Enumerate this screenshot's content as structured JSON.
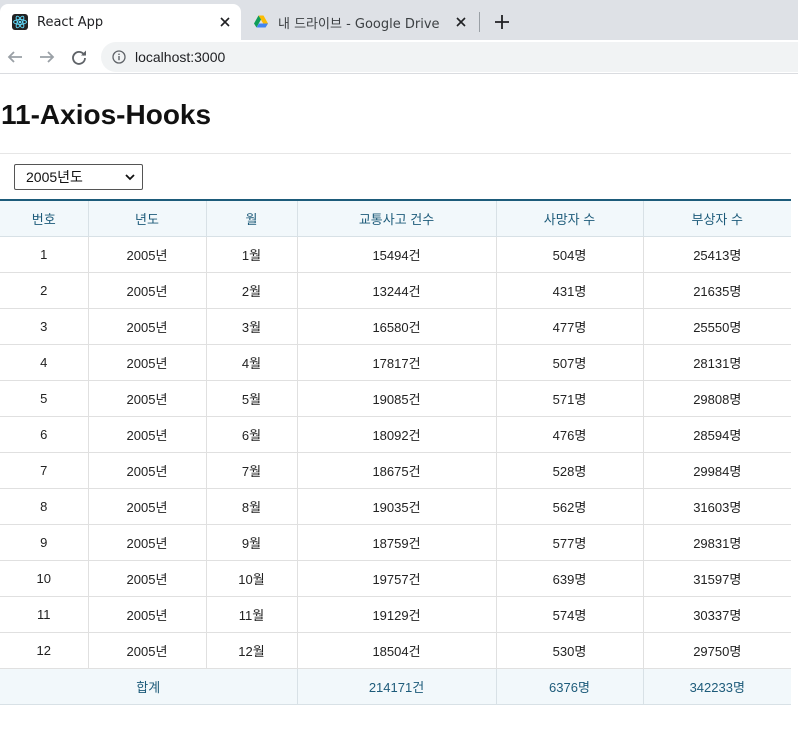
{
  "browser": {
    "active_tab_title": "React App",
    "inactive_tab_title": "내 드라이브 - Google Drive",
    "url": "localhost:3000"
  },
  "page": {
    "title": "11-Axios-Hooks",
    "year_select": {
      "selected": "2005년도"
    }
  },
  "table": {
    "headers": [
      "번호",
      "년도",
      "월",
      "교통사고 건수",
      "사망자 수",
      "부상자 수"
    ],
    "rows": [
      [
        "1",
        "2005년",
        "1월",
        "15494건",
        "504명",
        "25413명"
      ],
      [
        "2",
        "2005년",
        "2월",
        "13244건",
        "431명",
        "21635명"
      ],
      [
        "3",
        "2005년",
        "3월",
        "16580건",
        "477명",
        "25550명"
      ],
      [
        "4",
        "2005년",
        "4월",
        "17817건",
        "507명",
        "28131명"
      ],
      [
        "5",
        "2005년",
        "5월",
        "19085건",
        "571명",
        "29808명"
      ],
      [
        "6",
        "2005년",
        "6월",
        "18092건",
        "476명",
        "28594명"
      ],
      [
        "7",
        "2005년",
        "7월",
        "18675건",
        "528명",
        "29984명"
      ],
      [
        "8",
        "2005년",
        "8월",
        "19035건",
        "562명",
        "31603명"
      ],
      [
        "9",
        "2005년",
        "9월",
        "18759건",
        "577명",
        "29831명"
      ],
      [
        "10",
        "2005년",
        "10월",
        "19757건",
        "639명",
        "31597명"
      ],
      [
        "11",
        "2005년",
        "11월",
        "19129건",
        "574명",
        "30337명"
      ],
      [
        "12",
        "2005년",
        "12월",
        "18504건",
        "530명",
        "29750명"
      ]
    ],
    "footer": {
      "label": "합계",
      "accidents": "214171건",
      "deaths": "6376명",
      "injuries": "342233명"
    }
  },
  "colors": {
    "accent": "#1d5b7a",
    "header_bg": "#f2f8fb",
    "tabstrip_bg": "#dee1e6"
  },
  "icons": {
    "active_tab": "react-logo-icon",
    "inactive_tab": "google-drive-icon",
    "back": "arrow-left-icon",
    "forward": "arrow-right-icon",
    "reload": "reload-icon",
    "site_info": "info-icon",
    "select": "chevron-down-icon"
  }
}
